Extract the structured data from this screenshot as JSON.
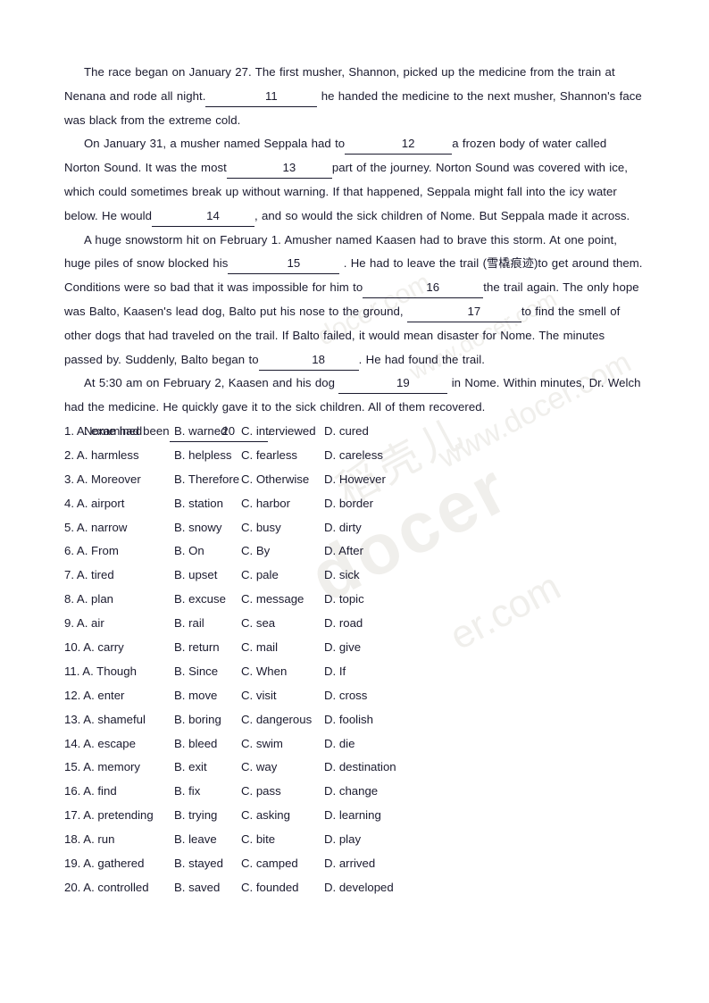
{
  "watermark": {
    "line1": "www.docer.com",
    "line2": "docer.com",
    "line3": "docer",
    "line4": "er.com",
    "line5": "稻壳儿",
    "line6": "www.docer.com"
  },
  "passage": {
    "paragraphs": [
      {
        "id": "p1",
        "runs": [
          {
            "type": "text",
            "value": "The race began on January 27. The first musher, Shannon, picked up the medicine from the train at Nenana and rode all night."
          },
          {
            "type": "blank",
            "value": "11",
            "width": "b-w1"
          },
          {
            "type": "text",
            "value": " he handed the medicine to the next musher, Shannon's face was black from the extreme cold."
          }
        ]
      },
      {
        "id": "p2",
        "runs": [
          {
            "type": "text",
            "value": "On January 31, a musher named Seppala had to"
          },
          {
            "type": "blank",
            "value": "12",
            "width": "b-w2"
          },
          {
            "type": "text",
            "value": "a frozen body of water called Norton Sound.  It was the most"
          },
          {
            "type": "blank",
            "value": "13",
            "width": "b-w3"
          },
          {
            "type": "text",
            "value": "part of the journey. Norton Sound was covered with ice, which could sometimes break up without warning. If that happened, Seppala might fall into the icy water below. He would"
          },
          {
            "type": "blank",
            "value": "14",
            "width": "b-w4"
          },
          {
            "type": "text",
            "value": ", and so would the sick children of Nome. But Seppala made it across."
          }
        ]
      },
      {
        "id": "p3",
        "runs": [
          {
            "type": "text",
            "value": "A huge snowstorm hit on February 1. Amusher named Kaasen had to brave this storm. At one point, huge piles of snow blocked his"
          },
          {
            "type": "blank",
            "value": "15",
            "width": "b-w5"
          },
          {
            "type": "text",
            "value": " . He had to leave the trail (雪橇痕迹)to get around them. Conditions were so bad that it was impossible for him to"
          },
          {
            "type": "blank",
            "value": "16",
            "width": "b-w6"
          },
          {
            "type": "text",
            "value": "the trail again. The only hope was Balto, Kaasen's lead dog, Balto put his nose to the ground, "
          },
          {
            "type": "blank",
            "value": "17",
            "width": "b-w7"
          },
          {
            "type": "text",
            "value": "to find the smell of other dogs that had traveled on the trail. If Balto failed, it would mean disaster for Nome. The minutes passed by. Suddenly, Balto began to"
          },
          {
            "type": "blank",
            "value": "18",
            "width": "b-w8"
          },
          {
            "type": "text",
            "value": ". He had found the trail."
          }
        ]
      },
      {
        "id": "p4",
        "runs": [
          {
            "type": "text",
            "value": "At 5:30 am on February 2, Kaasen and his dog "
          },
          {
            "type": "blank",
            "value": "19",
            "width": "b-w9"
          },
          {
            "type": "text",
            "value": " in Nome. Within minutes, Dr. Welch had the medicine. He quickly gave it to the sick children. All of them recovered."
          }
        ]
      },
      {
        "id": "p5",
        "runs": [
          {
            "type": "text",
            "value": "Nome had been"
          },
          {
            "type": "blank",
            "value": "20",
            "width": "b-w10"
          },
          {
            "type": "text",
            "value": "."
          }
        ]
      }
    ]
  },
  "questions": [
    {
      "number": "1.",
      "a": "A. examined",
      "b": "B. warned",
      "c": "C. interviewed",
      "d": "D. cured"
    },
    {
      "number": "2.",
      "a": "A. harmless",
      "b": "B. helpless",
      "c": "C. fearless",
      "d": "D. careless"
    },
    {
      "number": "3.",
      "a": "A. Moreover",
      "b": "B. Therefore",
      "c": "C. Otherwise",
      "d": "D. However"
    },
    {
      "number": "4.",
      "a": "A. airport",
      "b": "B. station",
      "c": "C. harbor",
      "d": "D. border"
    },
    {
      "number": "5.",
      "a": "A. narrow",
      "b": "B. snowy",
      "c": "C. busy",
      "d": "D. dirty"
    },
    {
      "number": "6.",
      "a": "A. From",
      "b": "B. On",
      "c": "C. By",
      "d": "D. After"
    },
    {
      "number": "7.",
      "a": "A. tired",
      "b": "B. upset",
      "c": "C. pale",
      "d": "D. sick"
    },
    {
      "number": "8.",
      "a": "A. plan",
      "b": "B. excuse",
      "c": "C. message",
      "d": "D. topic"
    },
    {
      "number": "9.",
      "a": "A. air",
      "b": "B. rail",
      "c": "C. sea",
      "d": "D. road"
    },
    {
      "number": "10.",
      "a": "A. carry",
      "b": "B. return",
      "c": "C. mail",
      "d": "D. give"
    },
    {
      "number": "11.",
      "a": "A. Though",
      "b": "B. Since",
      "c": "C. When",
      "d": "D. If"
    },
    {
      "number": "12.",
      "a": "A. enter",
      "b": "B. move",
      "c": "C. visit",
      "d": "D. cross"
    },
    {
      "number": "13.",
      "a": "A. shameful",
      "b": "B. boring",
      "c": "C. dangerous",
      "d": "D. foolish"
    },
    {
      "number": "14.",
      "a": "A. escape",
      "b": "B. bleed",
      "c": "C. swim",
      "d": "D. die"
    },
    {
      "number": "15.",
      "a": "A. memory",
      "b": "B. exit",
      "c": "C. way",
      "d": "D. destination"
    },
    {
      "number": "16.",
      "a": "A. find",
      "b": "B. fix",
      "c": "C. pass",
      "d": "D. change"
    },
    {
      "number": "17.",
      "a": "A. pretending",
      "b": "B. trying",
      "c": "C. asking",
      "d": "D. learning"
    },
    {
      "number": "18.",
      "a": "A. run",
      "b": "B. leave",
      "c": "C. bite",
      "d": "D. play"
    },
    {
      "number": "19.",
      "a": "A. gathered",
      "b": "B. stayed",
      "c": "C. camped",
      "d": "D. arrived"
    },
    {
      "number": "20.",
      "a": "A. controlled",
      "b": "B. saved",
      "c": "C. founded",
      "d": "D. developed"
    }
  ]
}
